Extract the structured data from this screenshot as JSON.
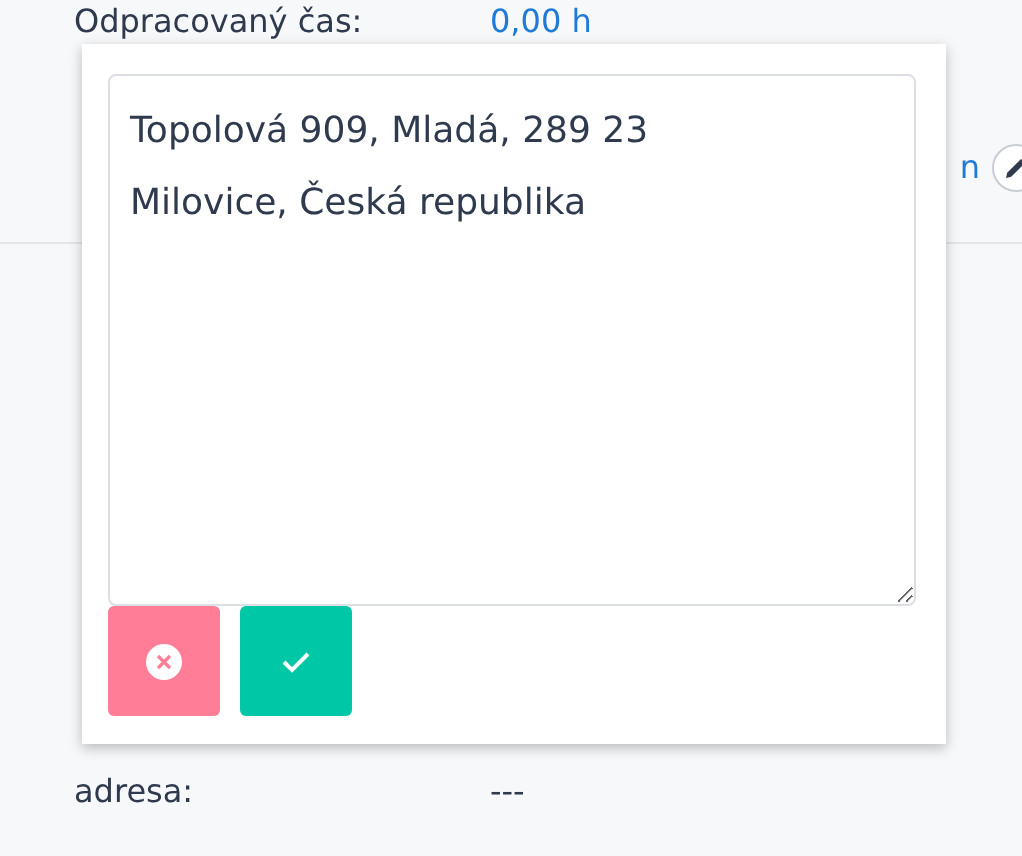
{
  "upper_fields": [
    {
      "label": "Odpracovaný čas:",
      "value": "0,00 h",
      "kind": "link",
      "editable": false
    },
    {
      "value": "n",
      "kind": "link",
      "editable": true
    }
  ],
  "lower_fields": [
    {
      "label": "adresa:",
      "value": "---",
      "kind": "plain"
    }
  ],
  "editor": {
    "value": "Topolová 909, Mladá, 289 23 Milovice, Česká republika"
  }
}
